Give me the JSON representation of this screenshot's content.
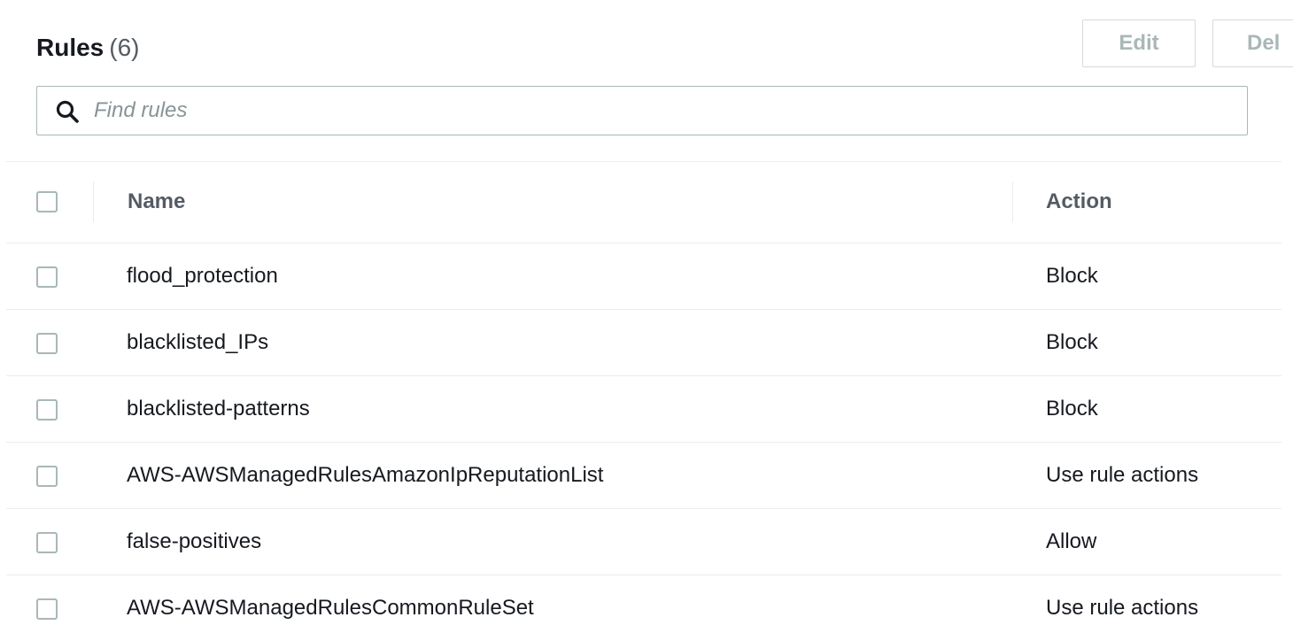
{
  "header": {
    "title": "Rules",
    "count": "(6)"
  },
  "toolbar": {
    "edit_label": "Edit",
    "delete_label": "Del"
  },
  "search": {
    "placeholder": "Find rules",
    "value": ""
  },
  "table": {
    "columns": {
      "name": "Name",
      "action": "Action"
    },
    "rows": [
      {
        "name": "flood_protection",
        "action": "Block"
      },
      {
        "name": "blacklisted_IPs",
        "action": "Block"
      },
      {
        "name": "blacklisted-patterns",
        "action": "Block"
      },
      {
        "name": "AWS-AWSManagedRulesAmazonIpReputationList",
        "action": "Use rule actions"
      },
      {
        "name": "false-positives",
        "action": "Allow"
      },
      {
        "name": "AWS-AWSManagedRulesCommonRuleSet",
        "action": "Use rule actions"
      }
    ]
  },
  "icons": {
    "search": "search-icon"
  },
  "colors": {
    "text": "#16191f",
    "muted": "#545b64",
    "disabled": "#aab7b8",
    "border": "#eaeded"
  }
}
